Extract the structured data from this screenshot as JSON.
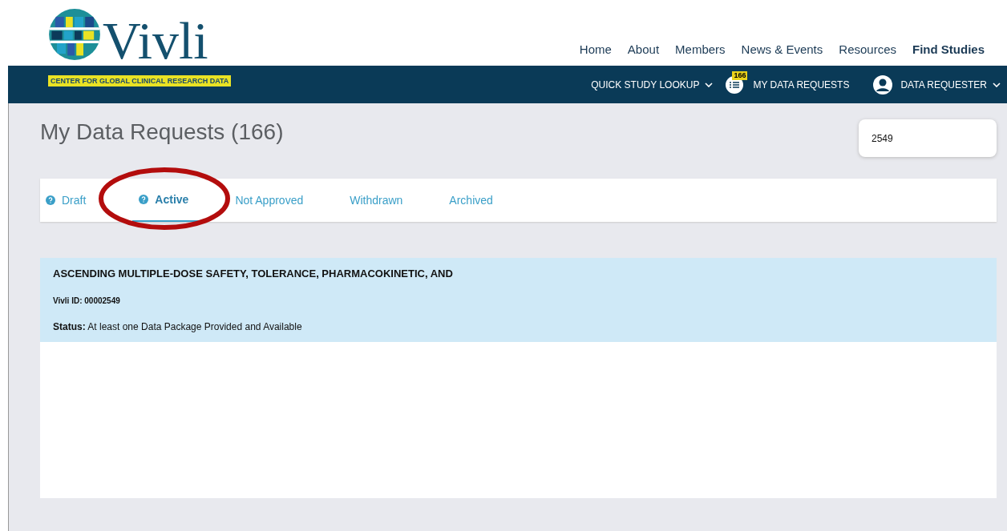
{
  "logo": {
    "name": "Vivli",
    "tagline": "CENTER FOR GLOBAL CLINICAL RESEARCH DATA"
  },
  "nav": [
    {
      "label": "Home",
      "selected": false
    },
    {
      "label": "About",
      "selected": false
    },
    {
      "label": "Members",
      "selected": false
    },
    {
      "label": "News & Events",
      "selected": false
    },
    {
      "label": "Resources",
      "selected": false
    },
    {
      "label": "Find Studies",
      "selected": true
    }
  ],
  "subnav": {
    "lookup": "QUICK STUDY LOOKUP",
    "requests_badge": "166",
    "requests": "MY DATA REQUESTS",
    "user": "DATA REQUESTER"
  },
  "page_title": "My Data Requests (166)",
  "search": {
    "value": "2549"
  },
  "tabs": [
    {
      "label": "Draft",
      "help": true,
      "selected": false
    },
    {
      "label": "Active",
      "help": true,
      "selected": true
    },
    {
      "label": "Not Approved",
      "help": false,
      "selected": false
    },
    {
      "label": "Withdrawn",
      "help": false,
      "selected": false
    },
    {
      "label": "Archived",
      "help": false,
      "selected": false
    }
  ],
  "request": {
    "title": "ASCENDING MULTIPLE-DOSE SAFETY, TOLERANCE, PHARMACOKINETIC, AND",
    "id_label": "Vivli ID:",
    "id": "00002549",
    "status_label": "Status:",
    "status": "At least one Data Package Provided and Available"
  }
}
